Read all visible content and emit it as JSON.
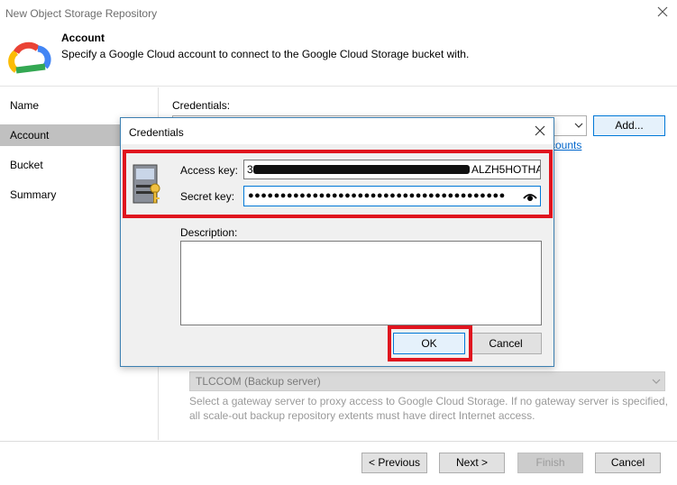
{
  "window": {
    "title": "New Object Storage Repository"
  },
  "header": {
    "title": "Account",
    "subtitle": "Specify a Google Cloud account to connect to the Google Cloud Storage bucket with.",
    "icon": "google-cloud-icon"
  },
  "sidebar": {
    "items": [
      {
        "label": "Name",
        "active": false
      },
      {
        "label": "Account",
        "active": true
      },
      {
        "label": "Bucket",
        "active": false
      },
      {
        "label": "Summary",
        "active": false
      }
    ]
  },
  "content": {
    "credentials_label": "Credentials:",
    "add_button": "Add...",
    "manage_link_partial": "counts",
    "gateway_server": "TLCCOM (Backup server)",
    "gateway_note_line1": "Select a gateway server to proxy access to Google Cloud Storage. If no gateway server is specified,",
    "gateway_note_line2": "all scale-out backup repository extents must have direct Internet access."
  },
  "footer": {
    "previous": "< Previous",
    "next": "Next >",
    "finish": "Finish",
    "cancel": "Cancel"
  },
  "dialog": {
    "title": "Credentials",
    "access_key_label": "Access key:",
    "access_key_first_char": "3",
    "access_key_visible_tail": "ALZH5HOTHA",
    "secret_key_label": "Secret key:",
    "secret_key_masked": "●●●●●●●●●●●●●●●●●●●●●●●●●●●●●●●●●●●●●●●●",
    "description_label": "Description:",
    "description_value": "",
    "ok_button": "OK",
    "cancel_button": "Cancel"
  },
  "colors": {
    "highlight": "#e0141e",
    "accent": "#0078d7",
    "active_step": "#c0c0c0"
  }
}
